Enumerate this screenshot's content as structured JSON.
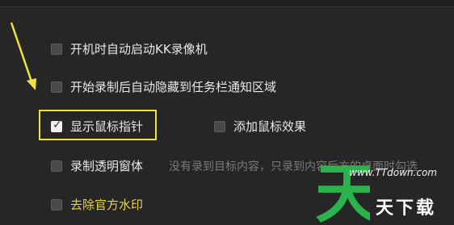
{
  "options": [
    {
      "label": "开机时自动启动KK录像机",
      "checked": false
    },
    {
      "label": "开始录制后自动隐藏到任务栏通知区域",
      "checked": false
    },
    {
      "label": "显示鼠标指针",
      "checked": true
    },
    {
      "label": "添加鼠标效果",
      "checked": false
    },
    {
      "label": "录制透明窗体",
      "checked": false
    },
    {
      "label": "去除官方水印",
      "checked": false
    }
  ],
  "transparent_hint": "没有录到目标内容，只录到内容后方的桌面时勾选",
  "watermark": {
    "logo_char": "天",
    "site_text": "天下载",
    "url": "www.TTdown.com"
  },
  "colors": {
    "highlight": "#f0e23a",
    "arrow": "#f0e23a",
    "watermark_green": "#2bb24c"
  }
}
